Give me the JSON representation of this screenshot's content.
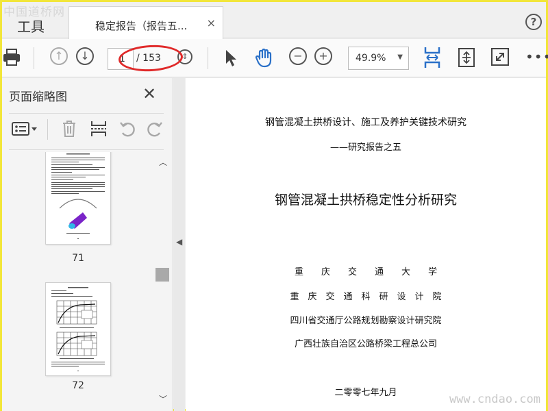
{
  "watermarks": {
    "top": "中国道桥网",
    "bottom": "www.cndao.com"
  },
  "tabs": {
    "tools_label": "工具",
    "doc_label": "稳定报告（报告五...",
    "close_glyph": "×",
    "help_glyph": "?"
  },
  "toolbar": {
    "current_page": "1",
    "total_pages": "/ 153",
    "zoom_value": "49.9%",
    "more_glyph": "•••",
    "icons": [
      "print-icon",
      "page-up-icon",
      "page-down-icon",
      "pointer-icon",
      "hand-icon",
      "zoom-out-icon",
      "zoom-in-icon",
      "fit-width-icon",
      "fit-page-icon",
      "full-screen-icon",
      "more-icon"
    ]
  },
  "annotation": {
    "color": "#e02a2a"
  },
  "sidebar": {
    "title": "页面缩略图",
    "thumbnails": [
      {
        "label": "71"
      },
      {
        "label": "72"
      }
    ]
  },
  "document": {
    "subtitle": "钢管混凝土拱桥设计、施工及养护关键技术研究",
    "series": "——研究报告之五",
    "title": "钢管混凝土拱桥稳定性分析研究",
    "institutions": [
      "重　　庆　　交　　通　　大　　学",
      "重　庆　交　通　科　研　设　计　院",
      "四川省交通厅公路规划勘察设计研究院",
      "广西壮族自治区公路桥梁工程总公司"
    ],
    "date": "二零零七年九月"
  },
  "colors": {
    "accent_blue": "#2a70c8",
    "border_yellow": "#f2e63a",
    "purple_shape": "#7a24c8"
  }
}
